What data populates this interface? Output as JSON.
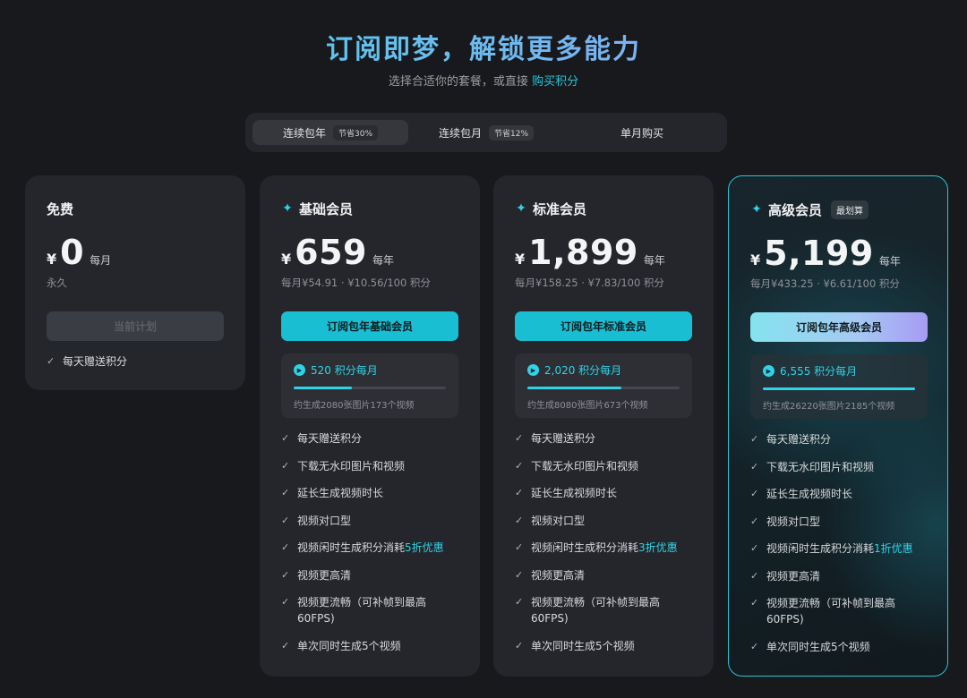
{
  "header": {
    "title": "订阅即梦，解锁更多能力",
    "subtitle_prefix": "选择合适你的套餐，或直接",
    "subtitle_link": "购买积分"
  },
  "tabs": [
    {
      "label": "连续包年",
      "badge": "节省30%",
      "active": true
    },
    {
      "label": "连续包月",
      "badge": "节省12%",
      "active": false
    },
    {
      "label": "单月购买",
      "badge": "",
      "active": false
    }
  ],
  "plans": {
    "free": {
      "name": "免费",
      "currency": "¥",
      "amount": "0",
      "period": "每月",
      "sub": "永久",
      "cta": "当前计划",
      "features": [
        "每天赠送积分"
      ]
    },
    "basic": {
      "name": "基础会员",
      "currency": "¥",
      "amount": "659",
      "period": "每年",
      "sub": "每月¥54.91 · ¥10.56/100 积分",
      "cta": "订阅包年基础会员",
      "credits": "520 积分每月",
      "credits_progress": 0.38,
      "credits_desc": "约生成2080张图片173个视频",
      "features": [
        "每天赠送积分",
        "下载无水印图片和视频",
        "延长生成视频时长",
        "视频对口型",
        "视频闲时生成积分消耗",
        "视频更高清",
        "视频更流畅（可补帧到最高",
        "60FPS)",
        "单次同时生成5个视频"
      ],
      "discount": "5折优惠"
    },
    "std": {
      "name": "标准会员",
      "currency": "¥",
      "amount": "1,899",
      "period": "每年",
      "sub": "每月¥158.25 · ¥7.83/100 积分",
      "cta": "订阅包年标准会员",
      "credits": "2,020 积分每月",
      "credits_progress": 0.62,
      "credits_desc": "约生成8080张图片673个视频",
      "features": [
        "每天赠送积分",
        "下载无水印图片和视频",
        "延长生成视频时长",
        "视频对口型",
        "视频闲时生成积分消耗",
        "视频更高清",
        "视频更流畅（可补帧到最高",
        "60FPS)",
        "单次同时生成5个视频"
      ],
      "discount": "3折优惠"
    },
    "adv": {
      "name": "高级会员",
      "badge": "最划算",
      "currency": "¥",
      "amount": "5,199",
      "period": "每年",
      "sub": "每月¥433.25 · ¥6.61/100 积分",
      "cta": "订阅包年高级会员",
      "credits": "6,555 积分每月",
      "credits_progress": 1.0,
      "credits_desc": "约生成26220张图片2185个视频",
      "features": [
        "每天赠送积分",
        "下载无水印图片和视频",
        "延长生成视频时长",
        "视频对口型",
        "视频闲时生成积分消耗",
        "视频更高清",
        "视频更流畅（可补帧到最高",
        "60FPS)",
        "单次同时生成5个视频"
      ],
      "discount": "1折优惠"
    }
  },
  "colors": {
    "accent": "#2fd3e6",
    "background": "#18191d",
    "card": "#24262b"
  }
}
